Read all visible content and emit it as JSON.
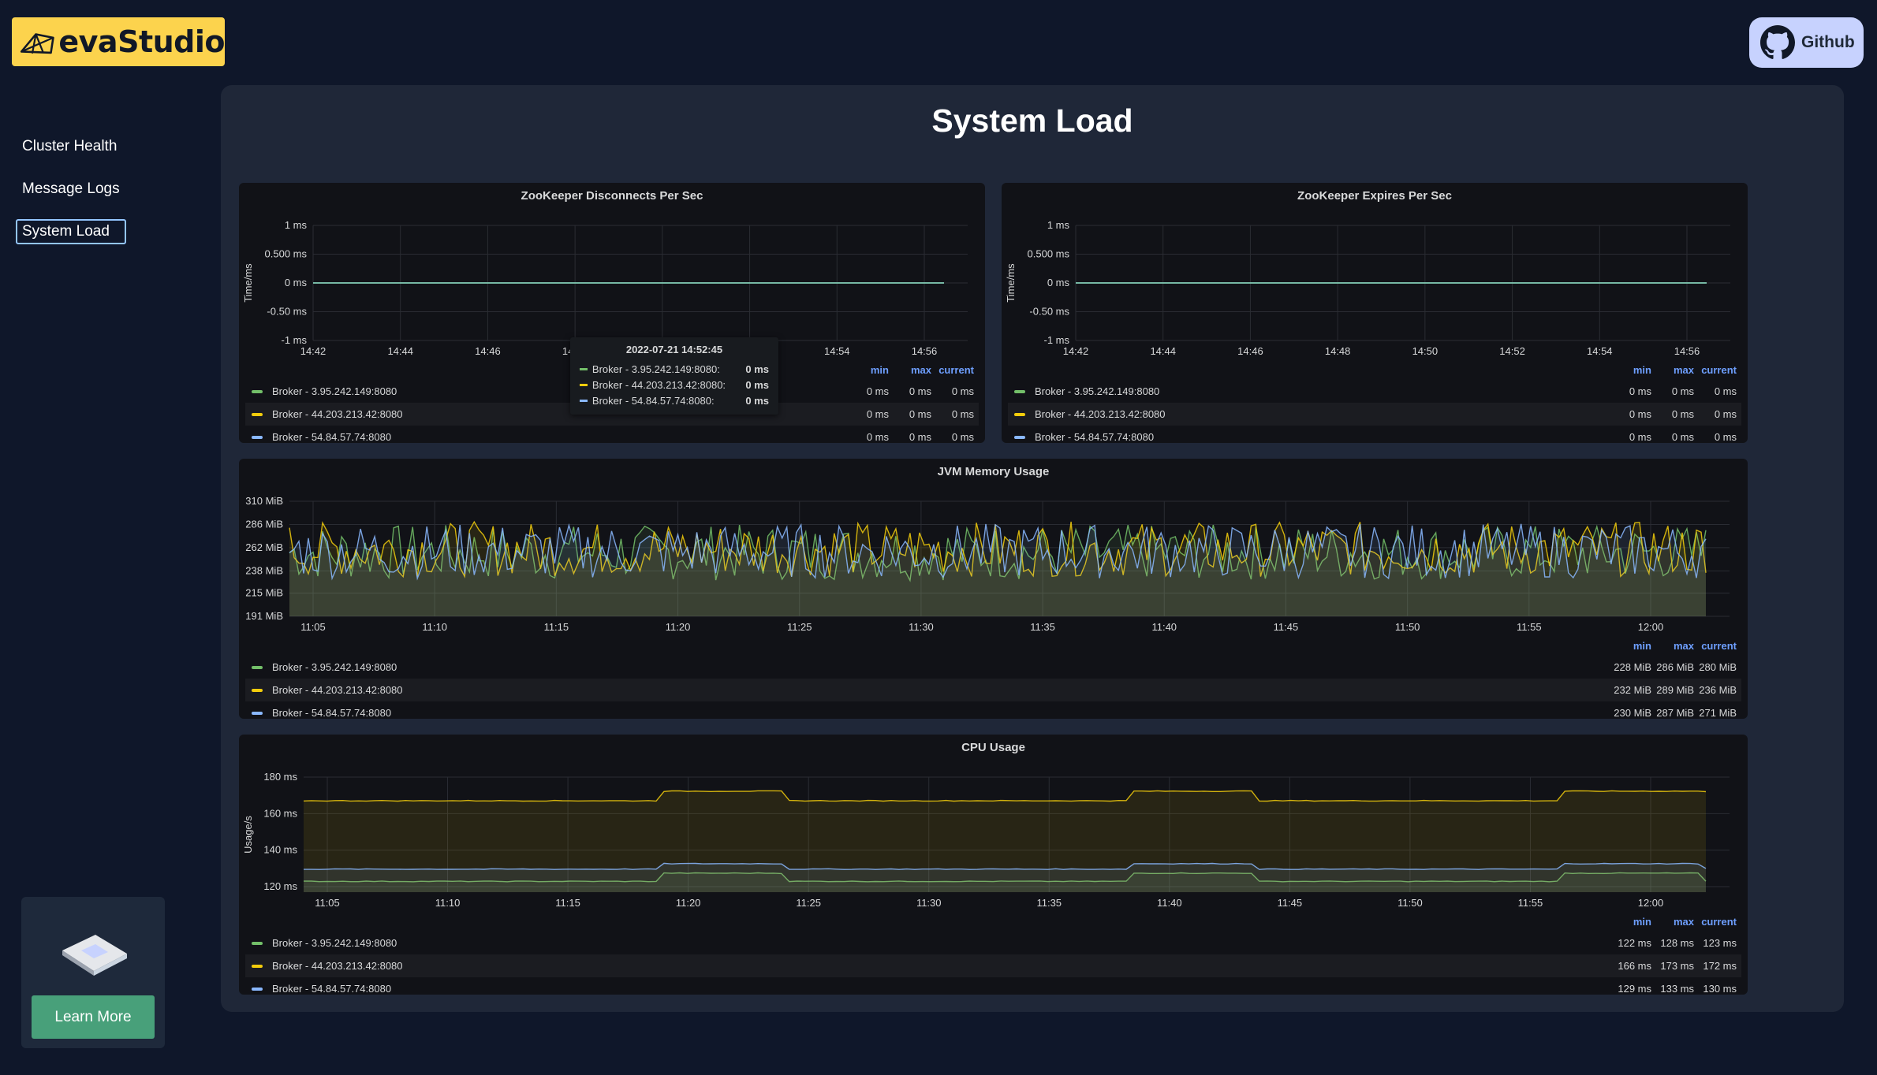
{
  "brand": {
    "name": "evaStudio"
  },
  "header": {
    "github_label": "Github"
  },
  "nav": {
    "items": [
      {
        "label": "Cluster Health",
        "active": false
      },
      {
        "label": "Message Logs",
        "active": false
      },
      {
        "label": "System Load",
        "active": true
      }
    ]
  },
  "promo": {
    "button_label": "Learn More"
  },
  "main": {
    "title": "System Load"
  },
  "colors": {
    "series": [
      "#73bf69",
      "#f2cc0c",
      "#8ab8ff"
    ],
    "background": "#0f172a",
    "panel": "#111217"
  },
  "legend_headers": {
    "min": "min",
    "max": "max",
    "current": "current"
  },
  "panels": [
    {
      "title": "ZooKeeper Disconnects Per Sec",
      "legend": [
        {
          "name": "Broker - 3.95.242.149:8080",
          "min": "0 ms",
          "max": "0 ms",
          "current": "0 ms"
        },
        {
          "name": "Broker - 44.203.213.42:8080",
          "min": "0 ms",
          "max": "0 ms",
          "current": "0 ms"
        },
        {
          "name": "Broker - 54.84.57.74:8080",
          "min": "0 ms",
          "max": "0 ms",
          "current": "0 ms"
        }
      ],
      "tooltip": {
        "time": "2022-07-21 14:52:45",
        "rows": [
          {
            "name": "Broker - 3.95.242.149:8080:",
            "value": "0 ms"
          },
          {
            "name": "Broker - 44.203.213.42:8080:",
            "value": "0 ms"
          },
          {
            "name": "Broker - 54.84.57.74:8080:",
            "value": "0 ms"
          }
        ]
      }
    },
    {
      "title": "ZooKeeper Expires Per Sec",
      "legend": [
        {
          "name": "Broker - 3.95.242.149:8080",
          "min": "0 ms",
          "max": "0 ms",
          "current": "0 ms"
        },
        {
          "name": "Broker - 44.203.213.42:8080",
          "min": "0 ms",
          "max": "0 ms",
          "current": "0 ms"
        },
        {
          "name": "Broker - 54.84.57.74:8080",
          "min": "0 ms",
          "max": "0 ms",
          "current": "0 ms"
        }
      ]
    },
    {
      "title": "JVM Memory Usage",
      "legend": [
        {
          "name": "Broker - 3.95.242.149:8080",
          "min": "228 MiB",
          "max": "286 MiB",
          "current": "280 MiB"
        },
        {
          "name": "Broker - 44.203.213.42:8080",
          "min": "232 MiB",
          "max": "289 MiB",
          "current": "236 MiB"
        },
        {
          "name": "Broker - 54.84.57.74:8080",
          "min": "230 MiB",
          "max": "287 MiB",
          "current": "271 MiB"
        }
      ]
    },
    {
      "title": "CPU Usage",
      "legend": [
        {
          "name": "Broker - 3.95.242.149:8080",
          "min": "122 ms",
          "max": "128 ms",
          "current": "123 ms"
        },
        {
          "name": "Broker - 44.203.213.42:8080",
          "min": "166 ms",
          "max": "173 ms",
          "current": "172 ms"
        },
        {
          "name": "Broker - 54.84.57.74:8080",
          "min": "129 ms",
          "max": "133 ms",
          "current": "130 ms"
        }
      ]
    }
  ],
  "chart_data": [
    {
      "type": "line",
      "title": "ZooKeeper Disconnects Per Sec",
      "ylabel": "Time/ms",
      "yticks": [
        "1 ms",
        "0.500 ms",
        "0 ms",
        "-0.50 ms",
        "-1 ms"
      ],
      "ylim": [
        -1,
        1
      ],
      "xticks": [
        "14:42",
        "14:44",
        "14:46",
        "14:48",
        "14:50",
        "14:52",
        "14:54",
        "14:56"
      ],
      "series": [
        {
          "name": "Broker - 3.95.242.149:8080",
          "values": [
            0,
            0,
            0,
            0,
            0,
            0,
            0,
            0
          ]
        },
        {
          "name": "Broker - 44.203.213.42:8080",
          "values": [
            0,
            0,
            0,
            0,
            0,
            0,
            0,
            0
          ]
        },
        {
          "name": "Broker - 54.84.57.74:8080",
          "values": [
            0,
            0,
            0,
            0,
            0,
            0,
            0,
            0
          ]
        }
      ]
    },
    {
      "type": "line",
      "title": "ZooKeeper Expires Per Sec",
      "ylabel": "Time/ms",
      "yticks": [
        "1 ms",
        "0.500 ms",
        "0 ms",
        "-0.50 ms",
        "-1 ms"
      ],
      "ylim": [
        -1,
        1
      ],
      "xticks": [
        "14:42",
        "14:44",
        "14:46",
        "14:48",
        "14:50",
        "14:52",
        "14:54",
        "14:56"
      ],
      "series": [
        {
          "name": "Broker - 3.95.242.149:8080",
          "values": [
            0,
            0,
            0,
            0,
            0,
            0,
            0,
            0
          ]
        },
        {
          "name": "Broker - 44.203.213.42:8080",
          "values": [
            0,
            0,
            0,
            0,
            0,
            0,
            0,
            0
          ]
        },
        {
          "name": "Broker - 54.84.57.74:8080",
          "values": [
            0,
            0,
            0,
            0,
            0,
            0,
            0,
            0
          ]
        }
      ]
    },
    {
      "type": "area",
      "title": "JVM Memory Usage",
      "ylabel": "",
      "yticks": [
        "310 MiB",
        "286 MiB",
        "262 MiB",
        "238 MiB",
        "215 MiB",
        "191 MiB"
      ],
      "ylim": [
        191,
        310
      ],
      "xticks": [
        "11:05",
        "11:10",
        "11:15",
        "11:20",
        "11:25",
        "11:30",
        "11:35",
        "11:40",
        "11:45",
        "11:50",
        "11:55",
        "12:00"
      ],
      "series": [
        {
          "name": "Broker - 3.95.242.149:8080",
          "min": 228,
          "max": 286,
          "current": 280
        },
        {
          "name": "Broker - 44.203.213.42:8080",
          "min": 232,
          "max": 289,
          "current": 236
        },
        {
          "name": "Broker - 54.84.57.74:8080",
          "min": 230,
          "max": 287,
          "current": 271
        }
      ]
    },
    {
      "type": "area",
      "title": "CPU Usage",
      "ylabel": "Usage/s",
      "yticks": [
        "180 ms",
        "160 ms",
        "140 ms",
        "120 ms"
      ],
      "ylim": [
        117,
        180
      ],
      "xticks": [
        "11:05",
        "11:10",
        "11:15",
        "11:20",
        "11:25",
        "11:30",
        "11:35",
        "11:40",
        "11:45",
        "11:50",
        "11:55",
        "12:00"
      ],
      "series": [
        {
          "name": "Broker - 3.95.242.149:8080",
          "min": 122,
          "max": 128,
          "current": 123
        },
        {
          "name": "Broker - 44.203.213.42:8080",
          "min": 166,
          "max": 173,
          "current": 172
        },
        {
          "name": "Broker - 54.84.57.74:8080",
          "min": 129,
          "max": 133,
          "current": 130
        }
      ]
    }
  ]
}
